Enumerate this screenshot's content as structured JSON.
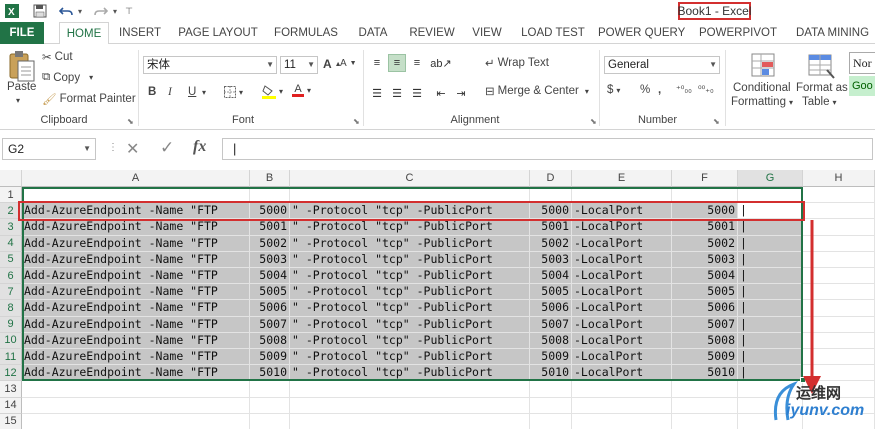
{
  "title_bar": {
    "doc_title": "Book1 - Excel",
    "app_icon": "excel-icon",
    "qat_icons": [
      "save-icon",
      "undo-icon",
      "redo-icon",
      "customize-icon"
    ]
  },
  "tabs": [
    "FILE",
    "HOME",
    "INSERT",
    "PAGE LAYOUT",
    "FORMULAS",
    "DATA",
    "REVIEW",
    "VIEW",
    "LOAD TEST",
    "POWER QUERY",
    "POWERPIVOT",
    "DATA MINING"
  ],
  "ribbon": {
    "clipboard": {
      "paste": "Paste",
      "cut": "Cut",
      "copy": "Copy",
      "format_painter": "Format Painter",
      "label": "Clipboard"
    },
    "font": {
      "name": "宋体",
      "size": "11",
      "label": "Font",
      "bold": "B",
      "italic": "I",
      "underline": "U",
      "grow": "A",
      "shrink": "A"
    },
    "alignment": {
      "wrap_text": "Wrap Text",
      "merge_center": "Merge & Center",
      "label": "Alignment"
    },
    "number": {
      "format": "General",
      "label": "Number",
      "currency": "$",
      "percent": "%",
      "comma": ","
    },
    "styles": {
      "conditional_formatting_1": "Conditional",
      "conditional_formatting_2": "Formatting",
      "format_as_table_1": "Format as",
      "format_as_table_2": "Table",
      "style_normal": "Nor",
      "style_good": "Goo"
    },
    "accent_color": "#217346"
  },
  "formula_bar": {
    "name_box": "G2",
    "cancel": "✕",
    "enter": "✓",
    "fx": "fx",
    "content": "|"
  },
  "columns": [
    "A",
    "B",
    "C",
    "D",
    "E",
    "F",
    "G",
    "H"
  ],
  "rows": [
    {
      "n": "1",
      "a": "",
      "b": "",
      "c": "",
      "d": "",
      "e": "",
      "f": "",
      "g": ""
    },
    {
      "n": "2",
      "a": "Add-AzureEndpoint -Name \"FTP",
      "b": "5000",
      "c": "\" -Protocol \"tcp\" -PublicPort",
      "d": "5000",
      "e": "-LocalPort",
      "f": "5000",
      "g": "|"
    },
    {
      "n": "3",
      "a": "Add-AzureEndpoint -Name \"FTP",
      "b": "5001",
      "c": "\" -Protocol \"tcp\" -PublicPort",
      "d": "5001",
      "e": "-LocalPort",
      "f": "5001",
      "g": "|"
    },
    {
      "n": "4",
      "a": "Add-AzureEndpoint -Name \"FTP",
      "b": "5002",
      "c": "\" -Protocol \"tcp\" -PublicPort",
      "d": "5002",
      "e": "-LocalPort",
      "f": "5002",
      "g": "|"
    },
    {
      "n": "5",
      "a": "Add-AzureEndpoint -Name \"FTP",
      "b": "5003",
      "c": "\" -Protocol \"tcp\" -PublicPort",
      "d": "5003",
      "e": "-LocalPort",
      "f": "5003",
      "g": "|"
    },
    {
      "n": "6",
      "a": "Add-AzureEndpoint -Name \"FTP",
      "b": "5004",
      "c": "\" -Protocol \"tcp\" -PublicPort",
      "d": "5004",
      "e": "-LocalPort",
      "f": "5004",
      "g": "|"
    },
    {
      "n": "7",
      "a": "Add-AzureEndpoint -Name \"FTP",
      "b": "5005",
      "c": "\" -Protocol \"tcp\" -PublicPort",
      "d": "5005",
      "e": "-LocalPort",
      "f": "5005",
      "g": "|"
    },
    {
      "n": "8",
      "a": "Add-AzureEndpoint -Name \"FTP",
      "b": "5006",
      "c": "\" -Protocol \"tcp\" -PublicPort",
      "d": "5006",
      "e": "-LocalPort",
      "f": "5006",
      "g": "|"
    },
    {
      "n": "9",
      "a": "Add-AzureEndpoint -Name \"FTP",
      "b": "5007",
      "c": "\" -Protocol \"tcp\" -PublicPort",
      "d": "5007",
      "e": "-LocalPort",
      "f": "5007",
      "g": "|"
    },
    {
      "n": "10",
      "a": "Add-AzureEndpoint -Name \"FTP",
      "b": "5008",
      "c": "\" -Protocol \"tcp\" -PublicPort",
      "d": "5008",
      "e": "-LocalPort",
      "f": "5008",
      "g": "|"
    },
    {
      "n": "11",
      "a": "Add-AzureEndpoint -Name \"FTP",
      "b": "5009",
      "c": "\" -Protocol \"tcp\" -PublicPort",
      "d": "5009",
      "e": "-LocalPort",
      "f": "5009",
      "g": "|"
    },
    {
      "n": "12",
      "a": "Add-AzureEndpoint -Name \"FTP",
      "b": "5010",
      "c": "\" -Protocol \"tcp\" -PublicPort",
      "d": "5010",
      "e": "-LocalPort",
      "f": "5010",
      "g": "|"
    },
    {
      "n": "13",
      "a": "",
      "b": "",
      "c": "",
      "d": "",
      "e": "",
      "f": "",
      "g": ""
    },
    {
      "n": "14",
      "a": "",
      "b": "",
      "c": "",
      "d": "",
      "e": "",
      "f": "",
      "g": ""
    },
    {
      "n": "15",
      "a": "",
      "b": "",
      "c": "",
      "d": "",
      "e": "",
      "f": "",
      "g": ""
    }
  ],
  "watermark": {
    "text_cn": "运维网",
    "text_en": "iyunv.com"
  },
  "annotation_color": "#d32f2f"
}
